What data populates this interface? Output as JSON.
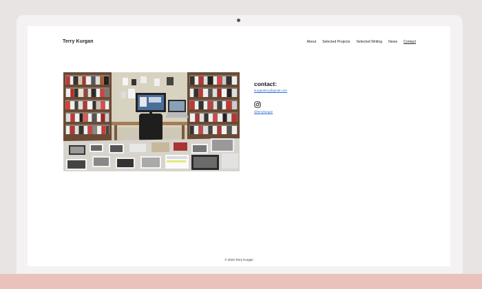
{
  "site": {
    "title": "Terry Kurgan"
  },
  "nav": {
    "items": [
      {
        "label": "About"
      },
      {
        "label": "Selected Projects"
      },
      {
        "label": "Selected Writing"
      },
      {
        "label": "News"
      },
      {
        "label": "Contact",
        "active": true
      }
    ]
  },
  "contact": {
    "heading": "contact:",
    "email": "kurganterry@gmail.com",
    "instagram_handle": "@terrykurgan",
    "instagram_icon": "instagram-icon"
  },
  "photo": {
    "subject": "studio-photo"
  },
  "footer": {
    "copyright": "© 2023 Terry Kurgan"
  },
  "colors": {
    "link": "#2a6fd1",
    "band": "#e9c3bb",
    "background": "#e8e4e4"
  }
}
